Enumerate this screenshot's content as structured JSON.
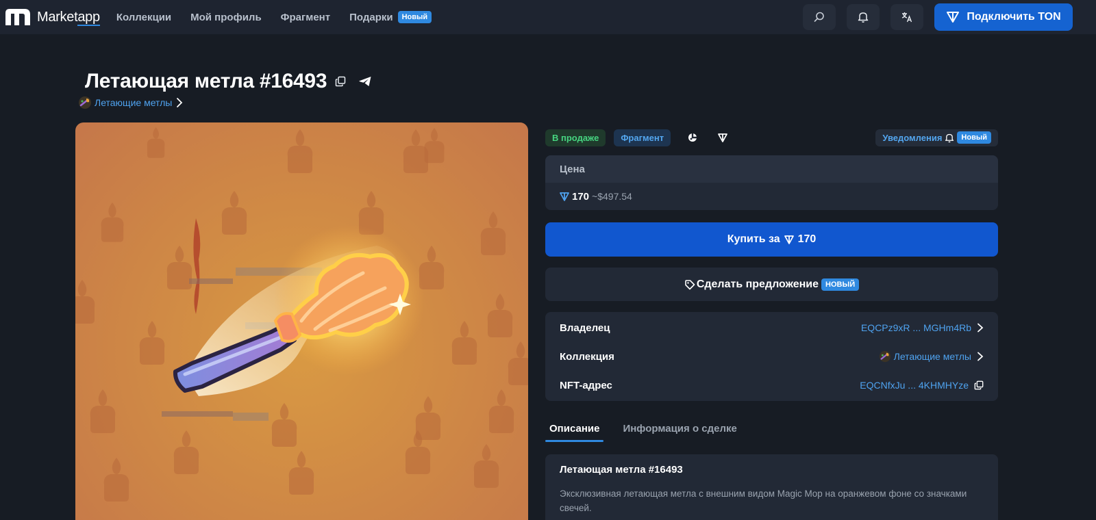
{
  "nav": {
    "logo_text": "Market",
    "logo_text_2": "app",
    "links": [
      "Коллекции",
      "Мой профиль",
      "Фрагмент",
      "Подарки"
    ],
    "new_badge": "Новый",
    "connect_label": "Подключить TON"
  },
  "nft": {
    "title": "Летающая метла #16493",
    "collection": "Летающие метлы",
    "background_color": "#d08a45"
  },
  "status": {
    "on_sale": "В продаже",
    "fragment": "Фрагмент",
    "notifications": "Уведомления",
    "new_badge": "Новый"
  },
  "price": {
    "label": "Цена",
    "amount": "170",
    "usd": "~$497.54"
  },
  "actions": {
    "buy_label": "Купить за",
    "buy_amount": "170",
    "offer_label": "Сделать предложение",
    "offer_badge": "НОВЫЙ"
  },
  "details": {
    "owner_label": "Владелец",
    "owner_value": "EQCPz9xR ... MGHm4Rb",
    "collection_label": "Коллекция",
    "collection_value": "Летающие метлы",
    "address_label": "NFT-адрес",
    "address_value": "EQCNfxJu ... 4KHMHYze"
  },
  "tabs": [
    "Описание",
    "Информация о сделке"
  ],
  "description": {
    "title": "Летающая метла #16493",
    "text": "Эксклюзивная летающая метла с внешним видом Magic Mop на оранжевом фоне со значками свечей."
  },
  "colors": {
    "accent": "#1563d1",
    "link": "#4fa3f0",
    "sale_green": "#46d480"
  }
}
